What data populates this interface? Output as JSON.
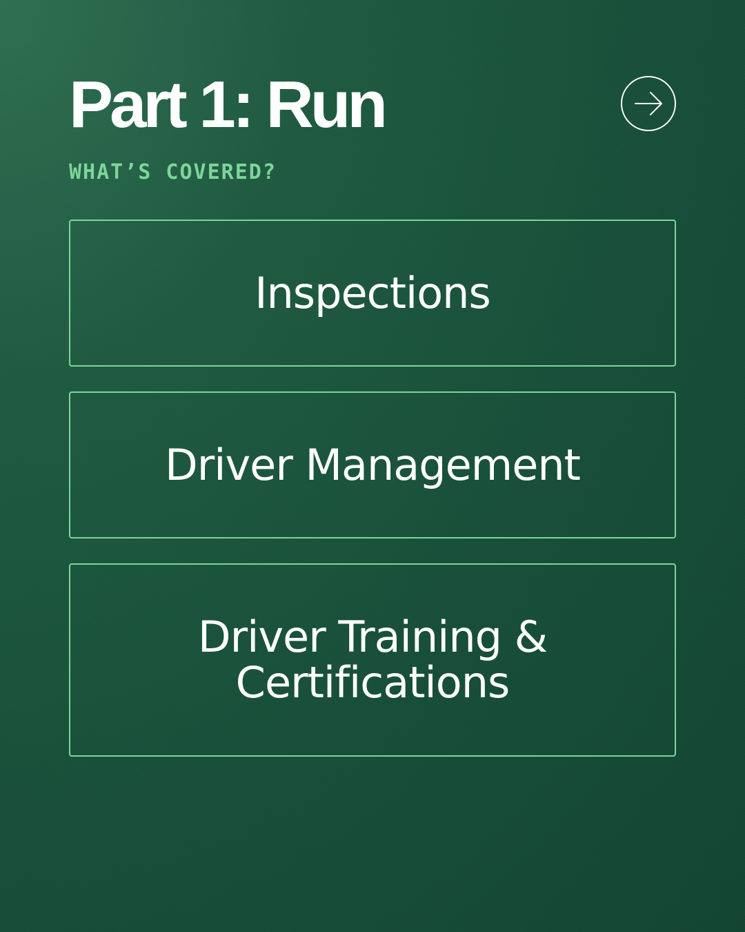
{
  "header": {
    "title": "Part 1: Run",
    "subtitle": "WHAT’S COVERED?",
    "next_icon": "arrow-right-circle-icon"
  },
  "topics": [
    {
      "lines": [
        "Inspections"
      ]
    },
    {
      "lines": [
        "Driver Management"
      ]
    },
    {
      "lines": [
        "Driver Training &",
        "Certifications"
      ]
    }
  ],
  "colors": {
    "background": "#1f5a40",
    "accent": "#7dd69a",
    "text": "#ffffff"
  }
}
